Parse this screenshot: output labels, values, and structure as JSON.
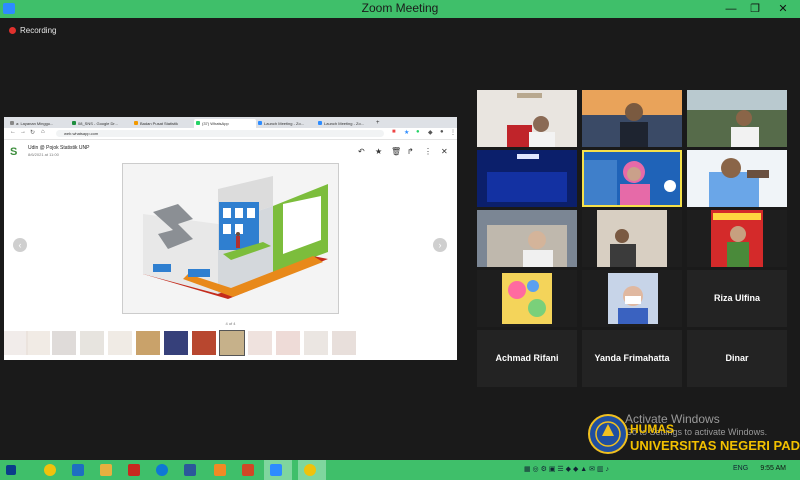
{
  "window": {
    "title": "Zoom Meeting",
    "minimize": "—",
    "maximize": "❐",
    "close": "✕"
  },
  "recording": {
    "label": "Recording"
  },
  "browser": {
    "tabs": [
      {
        "label": "a: Layanan Minggu..."
      },
      {
        "label": "08_SNS - Google Dr..."
      },
      {
        "label": "Badan Pusat Statistik"
      },
      {
        "label": "(37) WhatsApp"
      },
      {
        "label": "Launch Meeting - Zo..."
      },
      {
        "label": "Launch Meeting - Zo..."
      }
    ],
    "new_tab": "+",
    "url": "web.whatsapp.com",
    "chat": {
      "name": "Udin @ Pojok Statistik UNP",
      "date": "8/6/2021 at 11:00"
    },
    "image_counter": "4 of 4"
  },
  "participants": [
    {
      "name": "",
      "kind": "video"
    },
    {
      "name": "",
      "kind": "video"
    },
    {
      "name": "",
      "kind": "video"
    },
    {
      "name": "",
      "kind": "video"
    },
    {
      "name": "",
      "kind": "video",
      "active_speaker": true
    },
    {
      "name": "",
      "kind": "video"
    },
    {
      "name": "",
      "kind": "video"
    },
    {
      "name": "",
      "kind": "video"
    },
    {
      "name": "",
      "kind": "video"
    },
    {
      "name": "",
      "kind": "video"
    },
    {
      "name": "",
      "kind": "video"
    },
    {
      "name": "Riza Ulfina",
      "kind": "name"
    },
    {
      "name": "Achmad Rifani",
      "kind": "name"
    },
    {
      "name": "Yanda Frimahatta",
      "kind": "name"
    },
    {
      "name": "Dinar",
      "kind": "name"
    }
  ],
  "watermark": {
    "line1": "Activate Windows",
    "line2": "Go to Settings to activate Windows."
  },
  "logo": {
    "line1": "HUMAS",
    "line2": "UNIVERSITAS NEGERI PADANG",
    "seal_text": "UNP"
  },
  "taskbar": {
    "language": "ENG",
    "time": "9:55 AM"
  },
  "colors": {
    "title_bar": "#3fbf6a",
    "taskbar": "#3fbf6a",
    "active_speaker": "#f5e04a",
    "record_dot": "#e0312d"
  }
}
